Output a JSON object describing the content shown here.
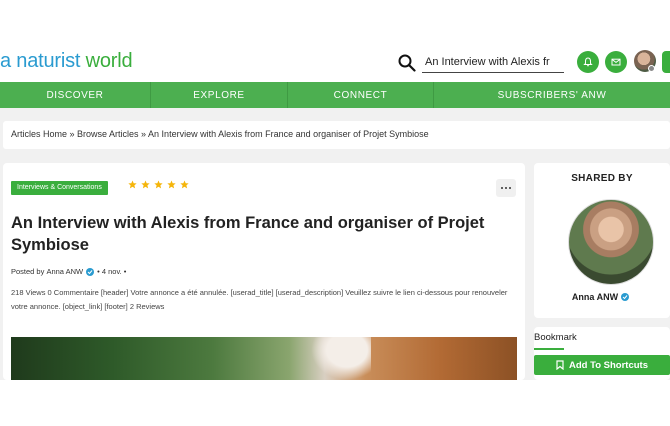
{
  "logo": {
    "prefix": "a naturist ",
    "suffix": "world"
  },
  "search": {
    "value": "An Interview with Alexis fr"
  },
  "nav": [
    {
      "label": "DISCOVER"
    },
    {
      "label": "EXPLORE"
    },
    {
      "label": "CONNECT"
    },
    {
      "label": "SUBSCRIBERS' ANW"
    }
  ],
  "breadcrumb": "Articles Home » Browse Articles » An Interview with Alexis from France and organiser of Projet Symbiose",
  "article": {
    "category": "Interviews & Conversations",
    "rating": 5,
    "title": "An Interview with Alexis from France and organiser of Projet Symbiose",
    "posted_by": "Posted by",
    "author": "Anna ANW",
    "date": "• 4 nov. •",
    "meta": "218 Views  0 Commentaire  [header] Votre annonce a été annulée. [userad_title] [userad_description] Veuillez suivre le lien ci-dessous pour renouveler votre annonce. [object_link] [footer]  2 Reviews"
  },
  "sidebar": {
    "shared_by": "SHARED BY",
    "author": "Anna ANW"
  },
  "bookmark": {
    "title": "Bookmark",
    "button": "Add To Shortcuts"
  },
  "colors": {
    "brand_green": "#4caf50",
    "brand_blue": "#2a9bd0",
    "star": "#f5b50a"
  }
}
